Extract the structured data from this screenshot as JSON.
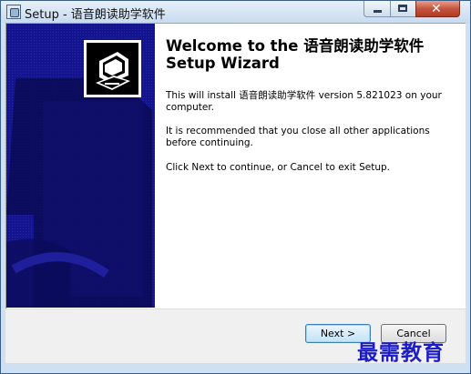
{
  "window": {
    "title": "Setup - 语音朗读助学软件",
    "controls": {
      "minimize_icon": "minimize-icon",
      "maximize_icon": "maximize-icon",
      "close_icon": "close-icon"
    }
  },
  "wizard": {
    "heading": "Welcome to the 语音朗读助学软件 Setup Wizard",
    "install_text": "This will install 语音朗读助学软件 version 5.821023 on your computer.",
    "recommend_text": "It is recommended that you close all other applications before continuing.",
    "continue_text": "Click Next to continue, or Cancel to exit Setup.",
    "logo_icon": "installer-computer-icon"
  },
  "buttons": {
    "next_label": "Next >",
    "cancel_label": "Cancel"
  },
  "watermark": "最需教育",
  "colors": {
    "side_panel": "#12128a",
    "side_shape": "#0a0a4f",
    "watermark": "#1c1cc8"
  }
}
